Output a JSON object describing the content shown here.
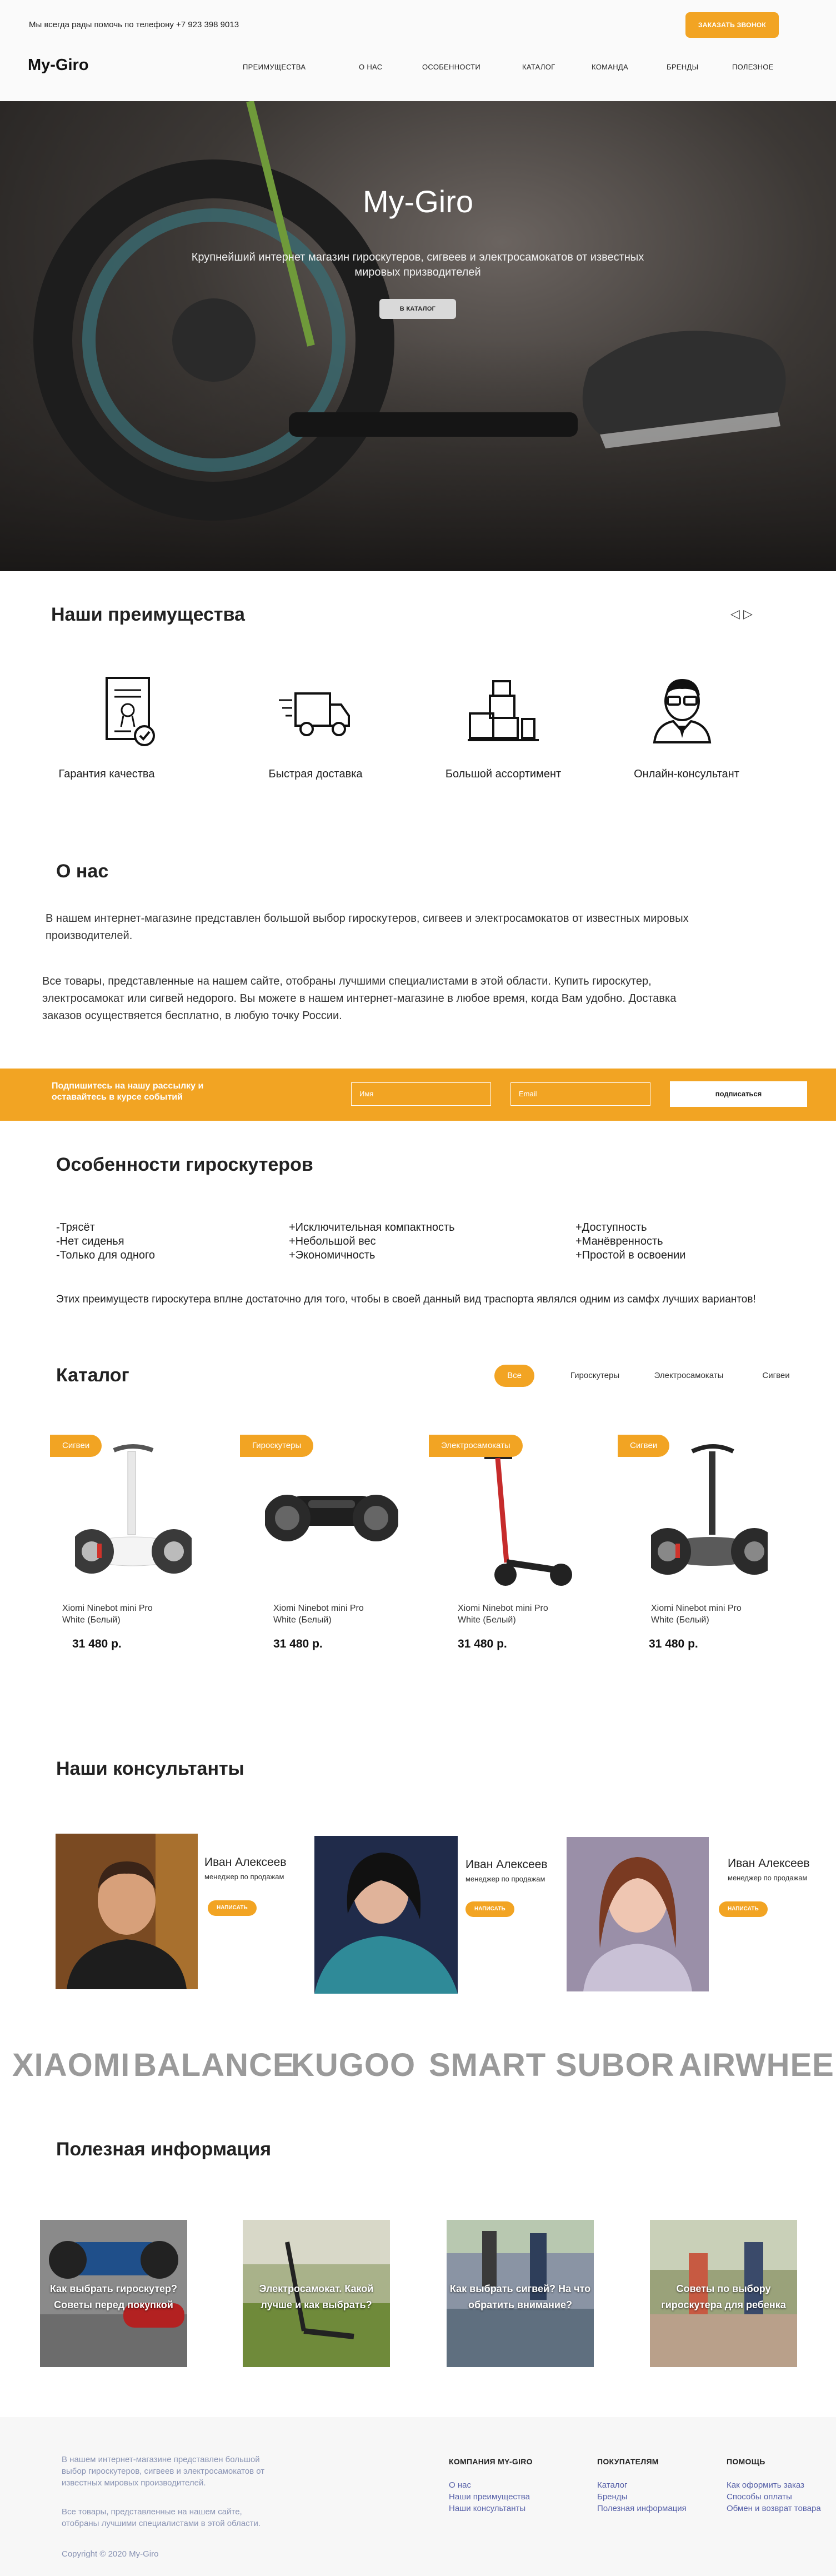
{
  "header": {
    "phone_text": "Мы всегда рады помочь по телефону +7 923 398 9013",
    "call_button": "ЗАКАЗАТЬ ЗВОНОК",
    "logo": "My-Giro",
    "nav": [
      "ПРЕИМУЩЕСТВА",
      "О НАС",
      "ОСОБЕННОСТИ",
      "КАТАЛОГ",
      "КОМАНДА",
      "БРЕНДЫ",
      "ПОЛЕЗНОЕ"
    ]
  },
  "hero": {
    "title": "My-Giro",
    "subtitle": "Крупнейший интернет магазин гироскутеров, сигвеев и электросамокатов от известных мировых призводителей",
    "button": "В КАТАЛОГ"
  },
  "advantages": {
    "title": "Наши преимущества",
    "arrows": "◁ ▷",
    "items": [
      {
        "label": "Гарантия качества",
        "icon": "certificate-icon"
      },
      {
        "label": "Быстрая доставка",
        "icon": "delivery-truck-icon"
      },
      {
        "label": "Большой ассортимент",
        "icon": "warehouse-boxes-icon"
      },
      {
        "label": "Онлайн-консультант",
        "icon": "consultant-icon"
      }
    ]
  },
  "about": {
    "title": "О нас",
    "p1": "В нашем интернет-магазине представлен большой выбор гироскутеров, сигвеев и электросамокатов  от известных мировых производителей.",
    "p2": "Все товары, представленные на нашем сайте, отобраны лучшими специалистами в этой области. Купить гироскутер, электросамокат или сигвей недорого. Вы можете в нашем интернет-магазине в любое время, когда Вам удобно. Доставка заказов осуществяется бесплатно, в любую точку России."
  },
  "subscribe": {
    "text": "Подпишитесь на нашу рассылку и оставайтесь в курсе событий",
    "name_placeholder": "Имя",
    "email_placeholder": "Email",
    "button": "подписаться"
  },
  "features": {
    "title": "Особенности гироскутеров",
    "columns": [
      [
        "-Трясёт",
        "-Нет сиденья",
        "-Только для одного"
      ],
      [
        "+Исключительная компактность",
        "+Небольшой вес",
        "+Экономичность"
      ],
      [
        "+Доступность",
        "+Манёвренность",
        "+Простой в освоении"
      ]
    ],
    "summary": "Этих преимуществ гироскутера вплне достаточно для того, чтобы в своей данный вид траспорта являлся одним из самфх лучших вариантов!"
  },
  "catalog": {
    "title": "Каталог",
    "filters": [
      "Все",
      "Гироскутеры",
      "Электросамокаты",
      "Сигвеи"
    ],
    "products": [
      {
        "tag": "Сигвеи",
        "name": "Xiomi Ninebot mini Pro White (Белый)",
        "price": "31 480 р."
      },
      {
        "tag": "Гироскутеры",
        "name": "Xiomi Ninebot mini Pro White (Белый)",
        "price": "31 480 р."
      },
      {
        "tag": "Электросамокаты",
        "name": "Xiomi Ninebot mini Pro White (Белый)",
        "price": "31 480 р."
      },
      {
        "tag": "Сигвеи",
        "name": "Xiomi Ninebot mini Pro White (Белый)",
        "price": "31 480 р."
      }
    ]
  },
  "consultants": {
    "title": "Наши консультанты",
    "items": [
      {
        "name": "Иван Алексеев",
        "role": "менеджер по продажам",
        "button": "НАПИСАТЬ"
      },
      {
        "name": "Иван Алексеев",
        "role": "менеджер по продажам",
        "button": "НАПИСАТЬ"
      },
      {
        "name": "Иван Алексеев",
        "role": "менеджер по продажам",
        "button": "НАПИСАТЬ"
      }
    ]
  },
  "brands": [
    "XIAOMI",
    "BALANCE",
    "KUGOO",
    "SMART",
    "SUBOR",
    "AIRWHEEL"
  ],
  "info": {
    "title": "Полезная информация",
    "cards": [
      "Как выбрать гироскутер? Советы перед покупкой",
      "Электросамокат. Какой лучше и как выбрать?",
      "Как выбрать сигвей? На что обратить внимание?",
      "Советы по выбору гироскутера для ребенка"
    ]
  },
  "footer": {
    "about1": "В нашем интернет-магазине представлен большой выбор гироскутеров, сигвеев и электросамокатов от известных мировых производителей.",
    "about2": "Все товары, представленные на нашем сайте, отобраны лучшими специалистами в этой области.",
    "copyright": "Copyright © 2020 My-Giro",
    "columns": [
      {
        "title": "КОМПАНИЯ MY-GIRO",
        "links": [
          "О нас",
          "Наши преимущества",
          "Наши консультанты"
        ]
      },
      {
        "title": "ПОКУПАТЕЛЯМ",
        "links": [
          "Каталог",
          "Бренды",
          "Полезная информация"
        ]
      },
      {
        "title": "ПОМОЩЬ",
        "links": [
          "Как оформить заказ",
          "Способы оплаты",
          "Обмен и возврат товара"
        ]
      }
    ]
  },
  "colors": {
    "accent": "#f2a423",
    "footer_link": "#5660a8",
    "footer_text": "#8a94b4",
    "brand_grey": "#9a9a9a"
  }
}
